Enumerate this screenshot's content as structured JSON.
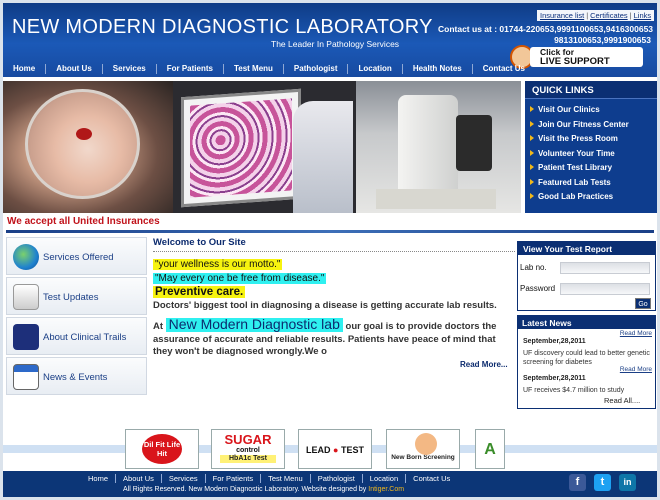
{
  "header": {
    "title": "NEW MODERN DIAGNOSTIC LABORATORY",
    "tagline": "The Leader In Pathology Services",
    "top_links": [
      "Insurance list",
      "Certificates",
      "Links"
    ],
    "contact_label": "Contact us at :",
    "contact_line1": "01744-220653,9991100653,9416300653",
    "contact_line2": "9813100653,9991900653",
    "support_line1": "Click for",
    "support_line2": "LIVE SUPPORT"
  },
  "nav": [
    "Home",
    "About Us",
    "Services",
    "For Patients",
    "Test Menu",
    "Pathologist",
    "Location",
    "Health Notes",
    "Contact Us"
  ],
  "quick_links": {
    "title": "QUICK LINKS",
    "items": [
      "Visit Our Clinics",
      "Join Our Fitness Center",
      "Visit the Press Room",
      "Volunteer Your Time",
      "Patient Test Library",
      "Featured Lab Tests",
      "Good Lab Practices"
    ]
  },
  "insurance_text": "We accept all United Insurances",
  "sidebar": [
    {
      "label": "Services Offered",
      "icon": "globe-icon"
    },
    {
      "label": "Test Updates",
      "icon": "note-icon"
    },
    {
      "label": "About Clinical Trails",
      "icon": "atom-icon"
    },
    {
      "label": "News & Events",
      "icon": "calendar-icon"
    }
  ],
  "main": {
    "heading": "Welcome to Our Site",
    "motto1": "\"your wellness is our motto.\"",
    "motto2": "\"May every one be free from disease.\"",
    "motto3": "Preventive care.",
    "line1": "Doctors' biggest tool in diagnosing a disease is getting accurate lab results.",
    "para_pre": "At ",
    "para_highlight": "New Modern Diagnostic lab",
    "para_post": " our goal is to provide doctors the assurance of accurate and reliable results. Patients have peace of mind that they won't be diagnosed wrongly.We o",
    "read_more": "Read More..."
  },
  "test_report": {
    "title": "View Your Test Report",
    "lab_label": "Lab no.",
    "password_label": "Password",
    "go_label": "Go"
  },
  "latest_news": {
    "title": "Latest News",
    "read_more": "Read More",
    "items": [
      {
        "date": "September,28,2011",
        "text": "UF discovery could lead to better genetic screening for diabetes"
      },
      {
        "date": "September,28,2011",
        "text": "UF receives $4.7 million to study"
      }
    ],
    "read_all": "Read All...."
  },
  "partners": {
    "p1": "Dil Fit Life Hit",
    "p2_main": "SUGAR",
    "p2_sub": "control",
    "p2_hb": "HbA1c Test",
    "p3_pre": "LEAD",
    "p3_post": "TEST",
    "p4": "New Born Screening",
    "p5": "A"
  },
  "footer": {
    "nav": [
      "Home",
      "About Us",
      "Services",
      "For Patients",
      "Test Menu",
      "Pathologist",
      "Location",
      "Contact Us"
    ],
    "copyright_pre": "All Rights Reserved. New Modern Diagnostic Laboratory. Website designed by ",
    "copyright_link": "Intiger.Com",
    "social": [
      {
        "icon": "facebook-icon",
        "glyph": "f",
        "color": "#3b5998"
      },
      {
        "icon": "twitter-icon",
        "glyph": "t",
        "color": "#1da1f2"
      },
      {
        "icon": "linkedin-icon",
        "glyph": "in",
        "color": "#0e76a8"
      }
    ]
  },
  "colors": {
    "brand_blue": "#0f3c86",
    "insurance_red": "#c0121a",
    "highlight_yellow": "#f7f30f",
    "highlight_cyan": "#2ff0f0"
  }
}
